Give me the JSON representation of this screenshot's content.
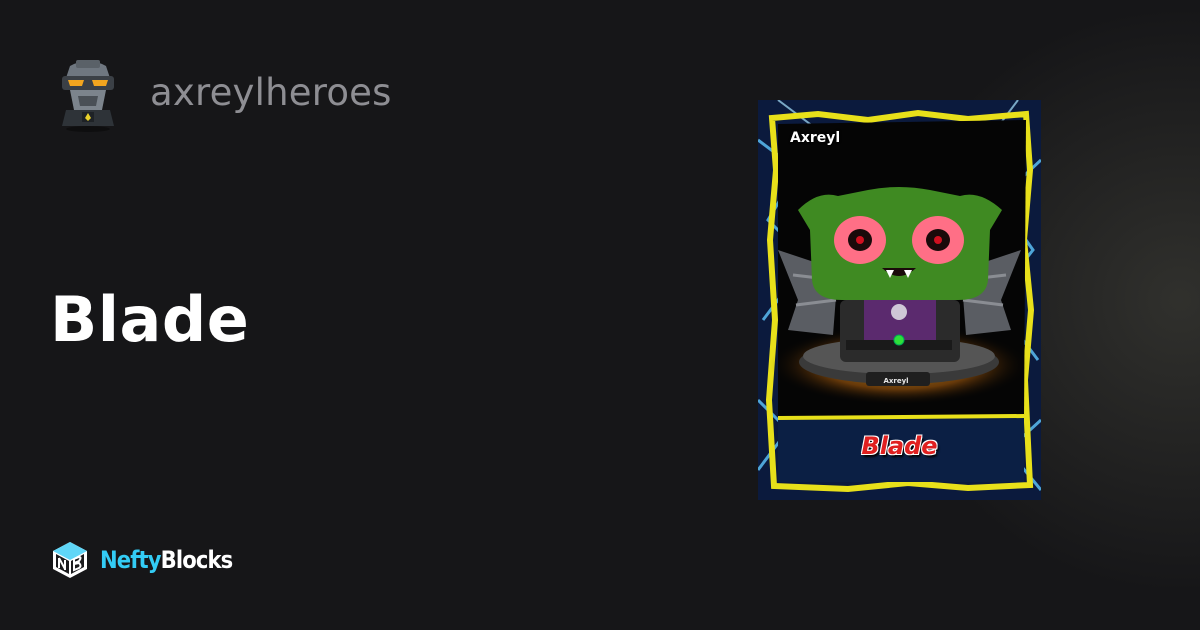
{
  "collection": {
    "name": "axreylheroes",
    "avatar_icon": "robot-avatar-icon"
  },
  "asset": {
    "title": "Blade"
  },
  "card_image": {
    "top_label": "Axreyl",
    "pedestal_label": "Axreyl",
    "bottom_label": "Blade",
    "colors": {
      "border": "#e8e01a",
      "character": "#3f8a22",
      "eyes": "#ff6f86",
      "shirt": "#5b2a6e",
      "background": "#0d1b3a"
    }
  },
  "brand": {
    "logo_icon": "neftyblocks-cube-icon",
    "name_part1": "Nefty",
    "name_part2": "Blocks",
    "colors": {
      "accent": "#33ccf5",
      "text": "#ffffff"
    }
  },
  "theme": {
    "background": "#161618",
    "title_color": "#ffffff",
    "muted_text": "#8e8e93"
  }
}
